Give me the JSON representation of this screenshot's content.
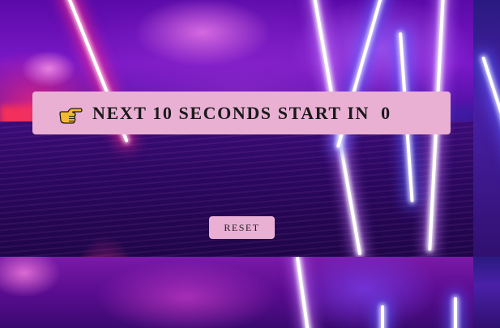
{
  "countdown_banner": {
    "icon": "pointing-hand-icon",
    "message": "NEXT 10 SECONDS START IN",
    "seconds_remaining": "0"
  },
  "controls": {
    "reset_label": "RESET"
  },
  "colors": {
    "banner_background": "#eab0d4",
    "button_background": "#eab0d4",
    "text": "#1a1a1a"
  }
}
